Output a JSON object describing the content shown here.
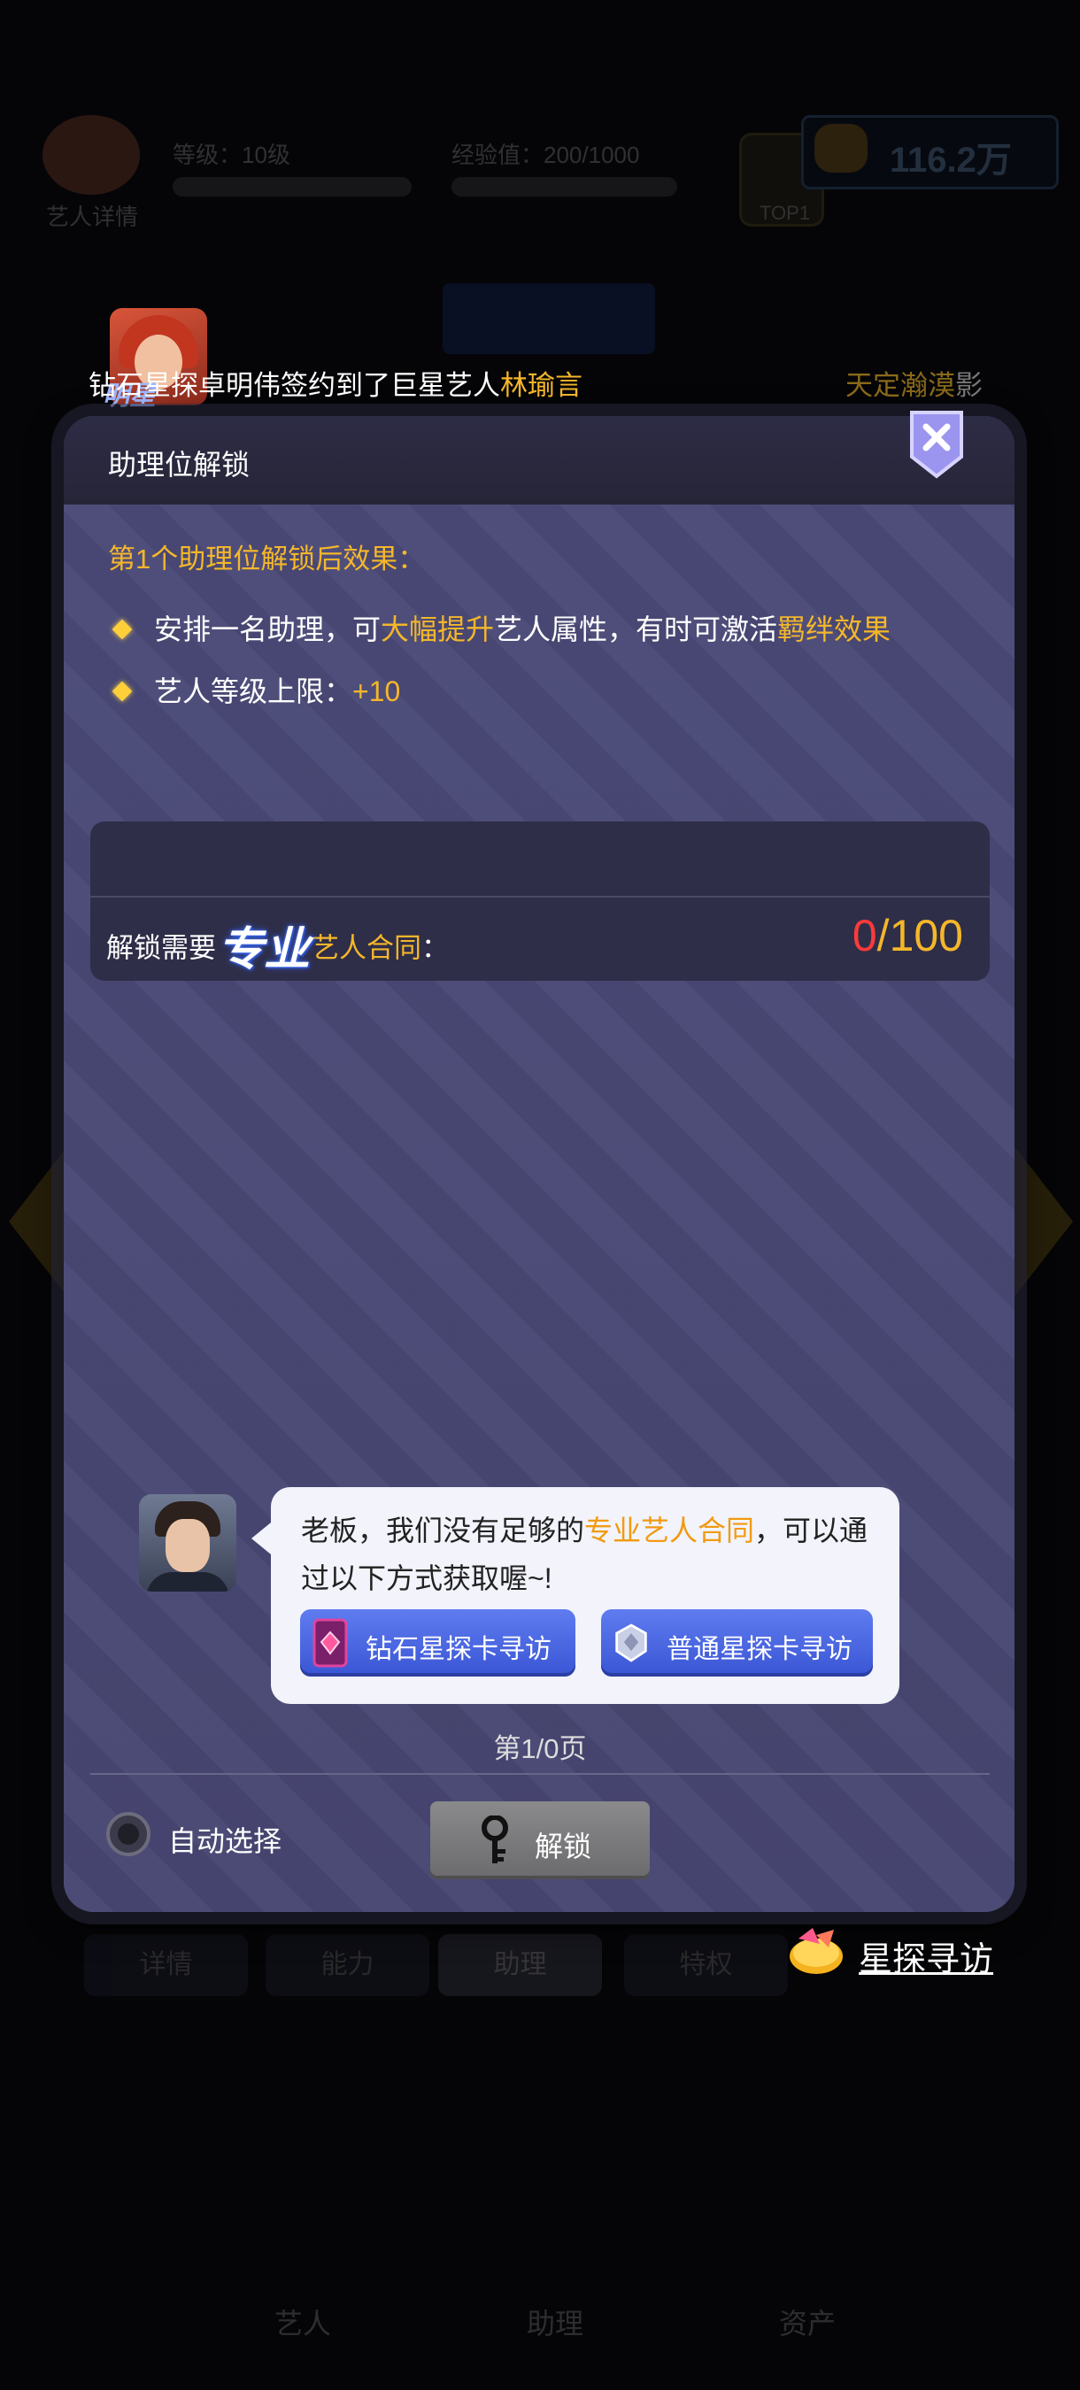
{
  "background": {
    "profile_label": "艺人详情",
    "level_label": "等级：10级",
    "exp_label": "经验值：200/1000",
    "coin_amount": "116.2万",
    "rank_label": "TOP1",
    "tabs": [
      {
        "label": "详情"
      },
      {
        "label": "能力"
      },
      {
        "label": "助理"
      },
      {
        "label": "特权"
      }
    ],
    "bottom_nav": [
      {
        "label": "艺人"
      },
      {
        "label": "助理"
      },
      {
        "label": "资产"
      }
    ]
  },
  "ticker": {
    "prefix": "钻石星探卓明伟签约到了巨星艺人",
    "artist_name": "林瑜言",
    "tag": "明星",
    "next_prefix": "天定瀚漠",
    "next_suffix": "影"
  },
  "dialog": {
    "title": "助理位解锁",
    "effect_heading": "第1个助理位解锁后效果：",
    "effects": [
      {
        "part1": "安排一名助理，可",
        "highlight1": "大幅提升",
        "part2": "艺人属性，有时可激活",
        "highlight2": "羁绊效果"
      },
      {
        "part1": "艺人等级上限：",
        "highlight1": "+10"
      }
    ],
    "requirement": {
      "prefix": "解锁需要",
      "badge": "专业",
      "contract": "艺人合同",
      "suffix": "：",
      "current": "0",
      "separator": "/",
      "required": "100"
    },
    "assistant_message": {
      "part1": "老板，我们没有足够的",
      "highlight": "专业艺人合同",
      "part2": "，可以通过以下方式获取喔~!"
    },
    "sources": [
      {
        "label": "钻石星探卡寻访"
      },
      {
        "label": "普通星探卡寻访"
      }
    ],
    "page_indicator": "第1/0页",
    "auto_select_label": "自动选择",
    "unlock_label": "解锁"
  },
  "scout_link": {
    "label": "星探寻访"
  },
  "colors": {
    "highlight": "#f5b72a",
    "count_current": "#ff3a3a",
    "dialog_bg": "#4b4a75",
    "button_blue": "#3a55d4"
  }
}
